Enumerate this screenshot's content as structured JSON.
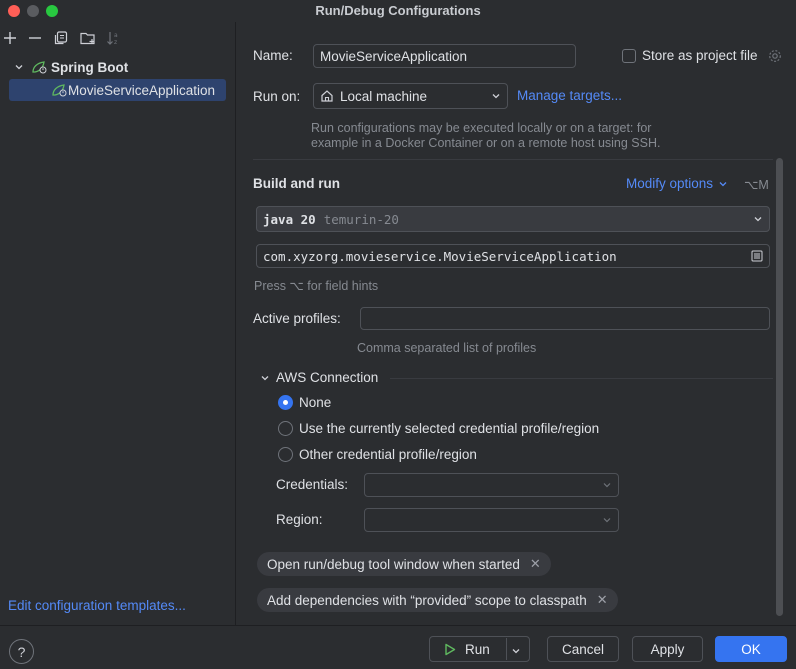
{
  "window": {
    "title": "Run/Debug Configurations"
  },
  "toolbar": {
    "icons": [
      "plus-icon",
      "minus-icon",
      "copy-icon",
      "new-folder-icon",
      "sort-icon"
    ]
  },
  "tree": {
    "group_label": "Spring Boot",
    "selected_item": "MovieServiceApplication"
  },
  "edit_templates": "Edit configuration templates...",
  "form": {
    "name_label": "Name:",
    "name_value": "MovieServiceApplication",
    "store_label": "Store as project file",
    "run_on_label": "Run on:",
    "run_on_value": "Local machine",
    "manage_targets": "Manage targets...",
    "run_on_hint_1": "Run configurations may be executed locally or on a target: for",
    "run_on_hint_2": "example in a Docker Container or on a remote host using SSH.",
    "build_run_label": "Build and run",
    "modify_options": "Modify options",
    "modify_shortcut": "⌥M",
    "jdk_name": "java 20",
    "jdk_detail": "temurin-20",
    "main_class": "com.xyzorg.movieservice.MovieServiceApplication",
    "field_hint": "Press ⌥ for field hints",
    "active_profiles_label": "Active profiles:",
    "active_profiles_value": "",
    "profiles_hint": "Comma separated list of profiles",
    "aws_label": "AWS Connection",
    "aws_options": [
      "None",
      "Use the currently selected credential profile/region",
      "Other credential profile/region"
    ],
    "aws_selected": "None",
    "credentials_label": "Credentials:",
    "region_label": "Region:",
    "chips": [
      "Open run/debug tool window when started",
      "Add dependencies with “provided” scope to classpath"
    ]
  },
  "buttons": {
    "help": "?",
    "run": "Run",
    "cancel": "Cancel",
    "apply": "Apply",
    "ok": "OK"
  },
  "colors": {
    "accent": "#3574f0",
    "link": "#548af7",
    "background": "#2b2d30",
    "spring_green": "#5fb85f"
  }
}
